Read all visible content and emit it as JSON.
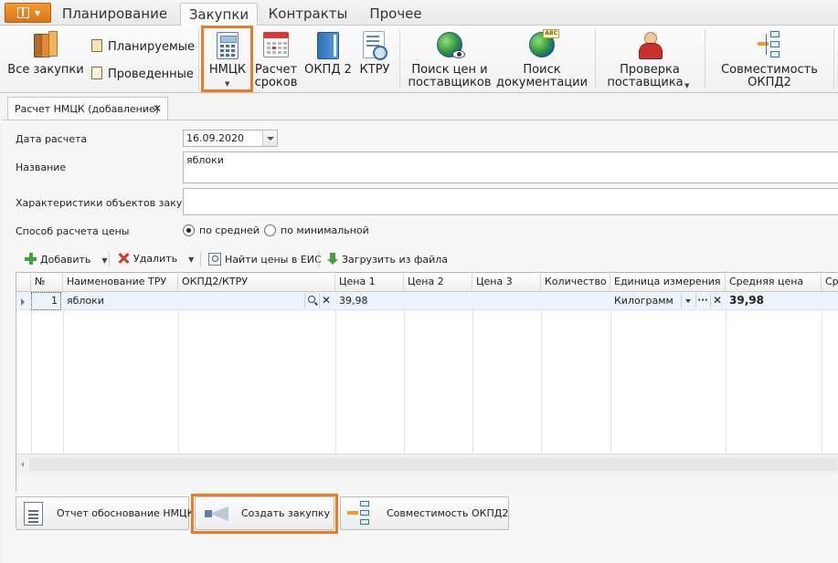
{
  "tabs": [
    {
      "label": "Планирование"
    },
    {
      "label": "Закупки"
    },
    {
      "label": "Контракты"
    },
    {
      "label": "Прочее"
    }
  ],
  "ribbon": {
    "all_purchases": "Все закупки",
    "planned": "Планируемые",
    "conducted": "Проведенные",
    "nmck": "НМЦК",
    "calc_terms_line1": "Расчет",
    "calc_terms_line2": "сроков",
    "okpd2": "ОКПД 2",
    "ktru": "КТРУ",
    "search_prices_line1": "Поиск цен и",
    "search_prices_line2": "поставщиков",
    "search_docs_line1": "Поиск",
    "search_docs_line2": "документации",
    "check_supplier_line1": "Проверка",
    "check_supplier_line2": "поставщика",
    "compat_line1": "Совместимость",
    "compat_line2": "ОКПД2"
  },
  "doc_tab": {
    "title": "Расчет НМЦК (добавление)",
    "close": "✕"
  },
  "form": {
    "date_label": "Дата расчета",
    "date_value": "16.09.2020",
    "name_label": "Название",
    "name_value": "яблоки",
    "chars_label": "Характеристики объектов закупки",
    "chars_value": "",
    "method_label": "Способ расчета цены",
    "method_avg": "по средней",
    "method_min": "по минимальной",
    "selected_method": "avg"
  },
  "grid_toolbar": {
    "add": "Добавить",
    "delete": "Удалить",
    "find_prices": "Найти цены в ЕИС",
    "load_file": "Загрузить из файла"
  },
  "grid": {
    "columns": [
      "№",
      "Наименование ТРУ",
      "ОКПД2/КТРУ",
      "Цена 1",
      "Цена 2",
      "Цена 3",
      "Количество",
      "Единица измерения",
      "Средняя цена",
      "Ср"
    ],
    "rows": [
      {
        "num": "1",
        "name": "яблоки",
        "okpd": "",
        "price1": "39,98",
        "price2": "",
        "price3": "",
        "qty": "",
        "unit": "Килограмм",
        "avg": "39,98"
      }
    ]
  },
  "bottom_buttons": {
    "report": "Отчет обоснование НМЦК",
    "create": "Создать закупку",
    "compat": "Совместимость ОКПД2"
  },
  "colors": {
    "highlight": "#ef7a22",
    "accent": "#d9731a"
  }
}
